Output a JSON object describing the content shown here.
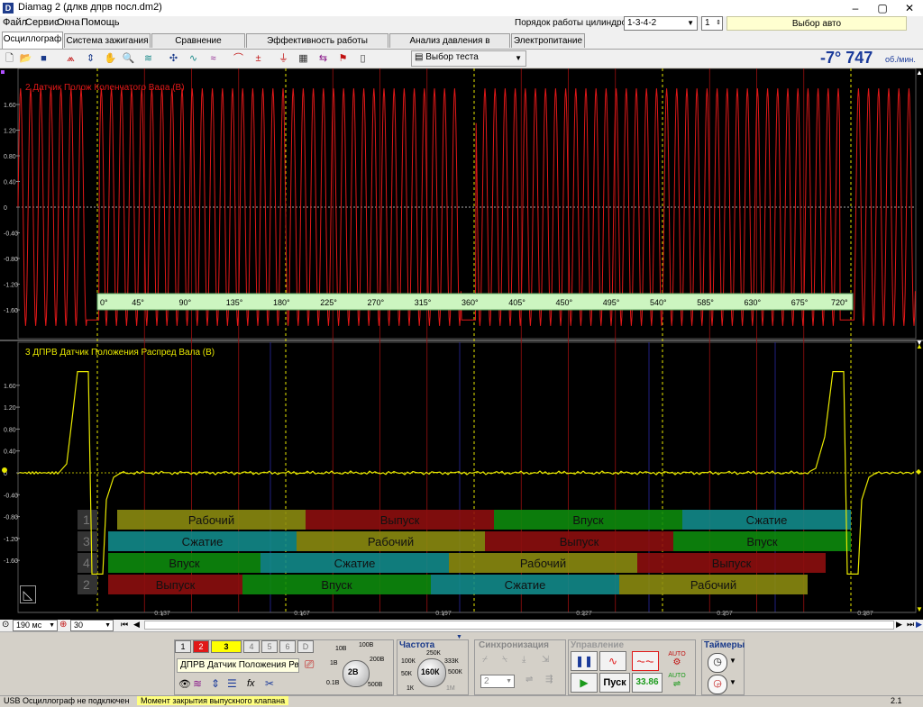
{
  "window": {
    "title": "Diamag 2 (длкв дпрв посл.dm2)",
    "minimize": "–",
    "maximize": "▢",
    "close": "✕"
  },
  "menu": [
    "Файл",
    "Сервис",
    "Окна",
    "Помощь"
  ],
  "firing_order": {
    "label": "Порядок работы цилиндров",
    "value": "1-3-4-2",
    "cyl_value": "1",
    "auto_button": "Выбор авто"
  },
  "tabs": [
    "Осциллограф",
    "Система зажигания",
    "Сравнение цилиндров",
    "Эффективность работы цилиндров",
    "Анализ давления в цилиндре",
    "Электропитание"
  ],
  "toolbar": {
    "test_select": "Выбор теста",
    "angle": "-7°",
    "rpm": "747",
    "rpm_unit": "об./мин."
  },
  "colors": {
    "ch1": "#e01818",
    "ch2": "#e8e800",
    "angle_bar": "#ccf5c0",
    "red_cell": "#8c0e0e",
    "green_cell": "#0d8a0d",
    "teal_cell": "#128a8a",
    "olive_cell": "#8a8a10"
  },
  "channel1": {
    "label": "2 Датчик Полож Коленчатого Вала (В)",
    "yticks": [
      "1.60",
      "1.20",
      "0.80",
      "0.40",
      "0",
      "-0.40",
      "-0.80",
      "-1.20",
      "-1.60"
    ],
    "angles": [
      "0°",
      "45°",
      "90°",
      "135°",
      "180°",
      "225°",
      "270°",
      "315°",
      "360°",
      "405°",
      "450°",
      "495°",
      "540°",
      "585°",
      "630°",
      "675°",
      "720°"
    ]
  },
  "channel2": {
    "label": "3 ДПРВ Датчик Положения Распред Вала (В)",
    "yticks": [
      "1.60",
      "1.20",
      "0.80",
      "0.40",
      "0",
      "-0.40",
      "-0.80",
      "-1.20",
      "-1.60"
    ]
  },
  "cycle_table": [
    {
      "cyl": "1",
      "cells": [
        "Рабочий",
        "Выпуск",
        "Впуск",
        "Сжатие"
      ]
    },
    {
      "cyl": "3",
      "cells": [
        "Сжатие",
        "Рабочий",
        "Выпуск",
        "Впуск"
      ]
    },
    {
      "cyl": "4",
      "cells": [
        "Впуск",
        "Сжатие",
        "Рабочий",
        "Выпуск"
      ]
    },
    {
      "cyl": "2",
      "cells": [
        "Выпуск",
        "Впуск",
        "Сжатие",
        "Рабочий"
      ]
    }
  ],
  "time_ticks": [
    "0.137",
    "0.167",
    "0.197",
    "0.227",
    "0.257",
    "0.287"
  ],
  "timebase": {
    "value": "190 мс",
    "trigger_value": "30"
  },
  "channel_buttons": [
    "1",
    "2",
    "3",
    "4",
    "5",
    "6",
    "D"
  ],
  "channel_select": "ДПРВ Датчик Положения Рас",
  "voltage_knob": {
    "value": "2В",
    "labels": [
      "10В",
      "100В",
      "1В",
      "200В",
      "0.1В",
      "500В"
    ]
  },
  "frequency": {
    "title": "Частота",
    "value": "160К",
    "labels": [
      "250К",
      "100К",
      "333К",
      "50К",
      "500К",
      "1К",
      "1М"
    ]
  },
  "sync": {
    "title": "Синхронизация",
    "value": "2"
  },
  "control": {
    "title": "Управление",
    "start": "Пуск",
    "freq_value": "33.86",
    "auto_label": "AUTO"
  },
  "timers": {
    "title": "Таймеры"
  },
  "status": {
    "left": "USB Осциллограф не подключен",
    "middle": "Момент закрытия выпускного клапана",
    "right": "2.1"
  }
}
